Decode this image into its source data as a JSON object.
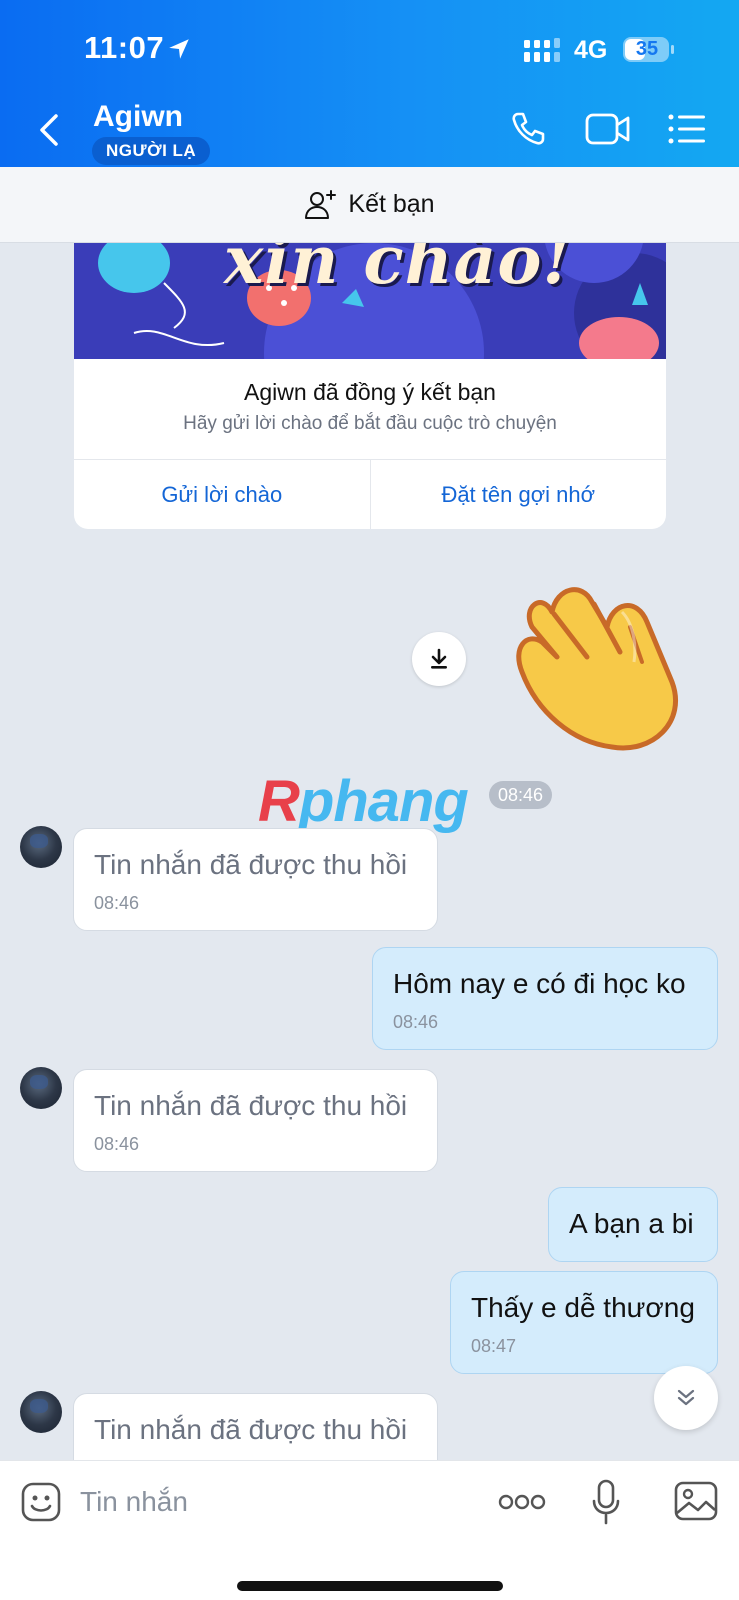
{
  "status_bar": {
    "time": "11:07",
    "network": "4G",
    "battery": "35"
  },
  "header": {
    "contact_name": "Agiwn",
    "badge": "NGƯỜI LẠ"
  },
  "friend_bar": {
    "label": "Kết bạn"
  },
  "greeting_card": {
    "banner_text": "xin chào!",
    "title": "Agiwn đã đồng ý kết bạn",
    "subtitle": "Hãy gửi lời chào để bắt đầu cuộc trò chuyện",
    "actions": [
      "Gửi lời chào",
      "Đặt tên gợi nhớ"
    ]
  },
  "watermark": {
    "first": "R",
    "rest": "phang"
  },
  "time_divider": "08:46",
  "messages": [
    {
      "direction": "in",
      "text": "Tin nhắn đã được thu hồi",
      "time": "08:46"
    },
    {
      "direction": "out",
      "text": "Hôm nay e có đi học ko",
      "time": "08:46"
    },
    {
      "direction": "in",
      "text": "Tin nhắn đã được thu hồi",
      "time": "08:46"
    },
    {
      "direction": "out",
      "text": "A bạn a bi",
      "time": ""
    },
    {
      "direction": "out",
      "text": "Thấy e dễ thương",
      "time": "08:47"
    },
    {
      "direction": "in",
      "text": "Tin nhắn đã được thu hồi",
      "time": ""
    }
  ],
  "composer": {
    "placeholder": "Tin nhắn"
  },
  "icons": [
    "location-arrow-icon",
    "signal-icon",
    "battery-icon",
    "back-icon",
    "phone-icon",
    "video-call-icon",
    "menu-list-icon",
    "add-user-icon",
    "download-icon",
    "wave-hand-sticker",
    "scroll-down-icon",
    "emoji-icon",
    "more-icon",
    "microphone-icon",
    "image-icon"
  ],
  "colors": {
    "header_start": "#0a6cf2",
    "header_end": "#14a8f2",
    "outgoing_bubble": "#d4ecfc",
    "link_blue": "#1466d6",
    "chat_bg": "#e3e8ef"
  }
}
